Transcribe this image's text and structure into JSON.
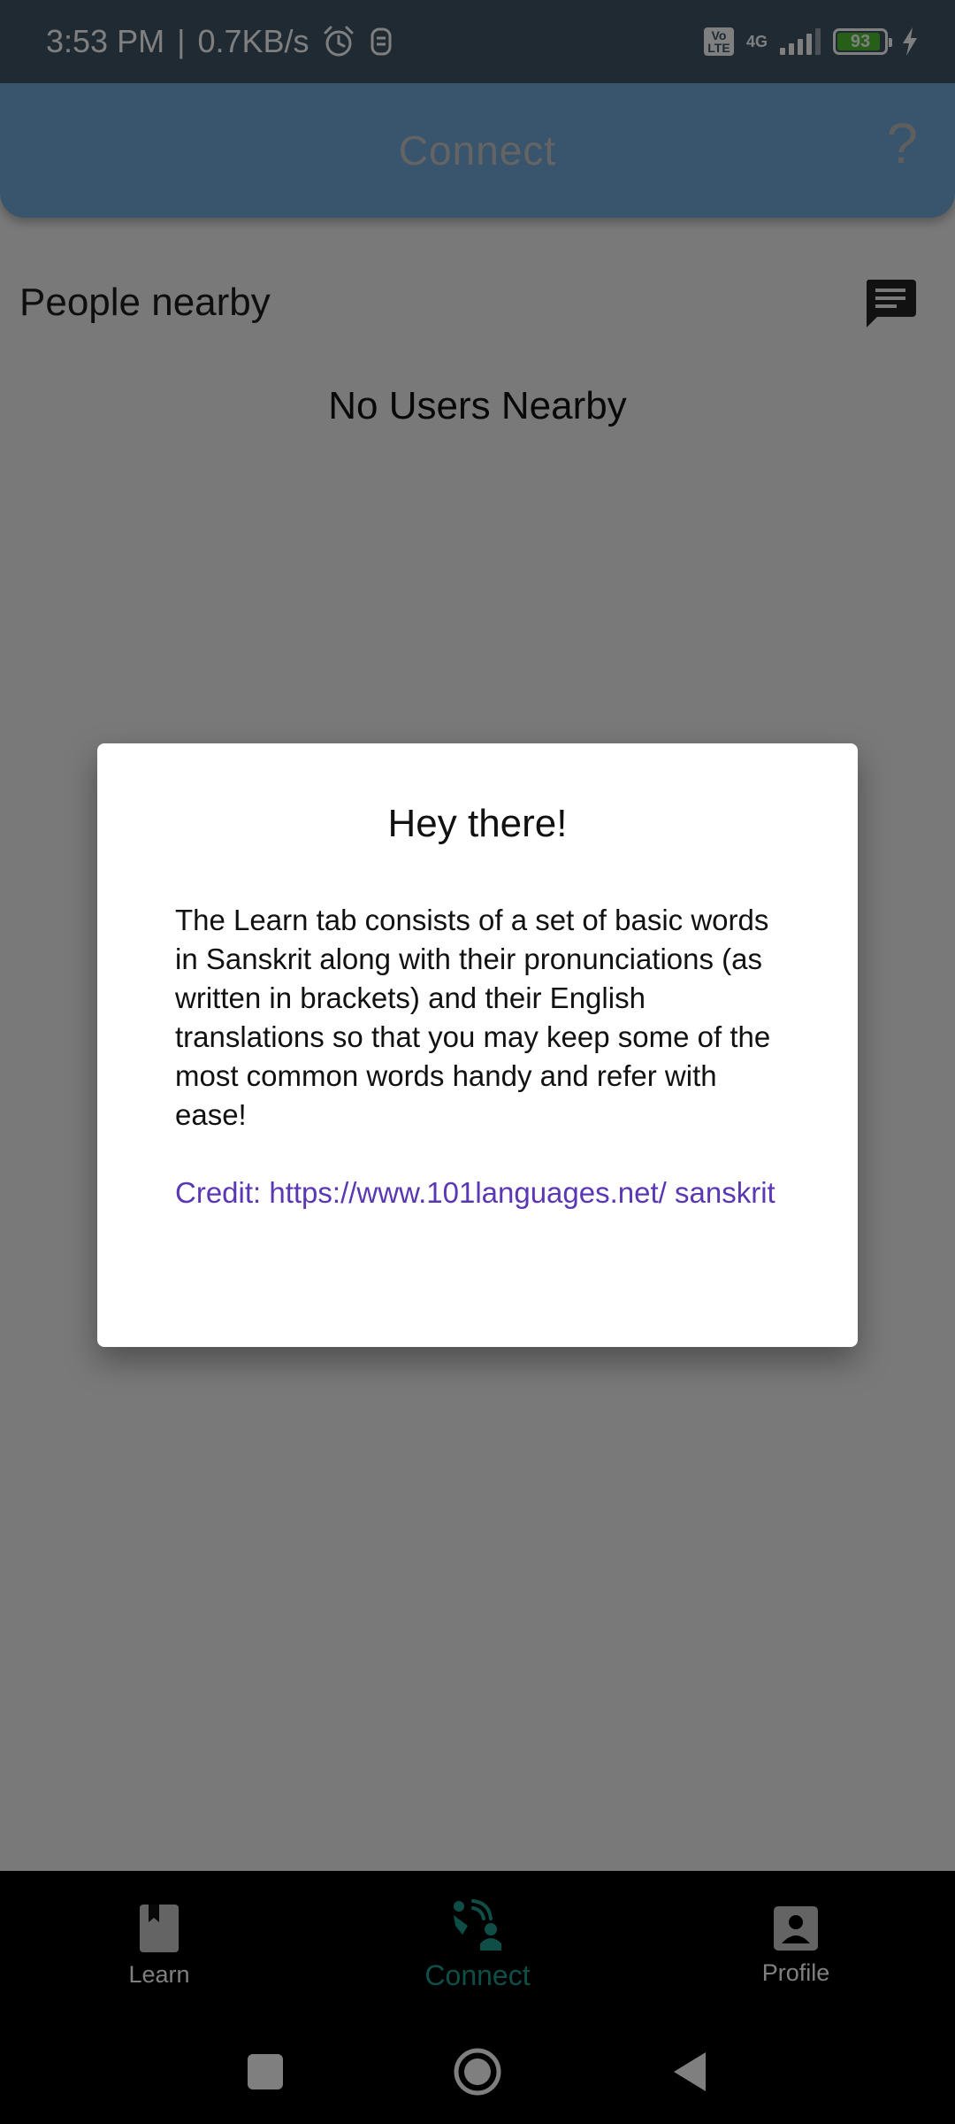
{
  "status_bar": {
    "time": "3:53 PM",
    "separator": "|",
    "speed": "0.7KB/s",
    "volte": "Vo LTE",
    "network": "4G",
    "battery": "93",
    "battery_level": 0.93
  },
  "app_bar": {
    "title": "Connect",
    "help": "?"
  },
  "section": {
    "title": "People nearby",
    "empty_message": "No Users Nearby"
  },
  "dialog": {
    "title": "Hey there!",
    "body": "The Learn tab consists of a set of basic words in Sanskrit along with their pronunciations (as written in brackets) and their English translations so that you may keep some of the most common words handy and refer with ease!",
    "credit": "Credit: https://www.101languages.net/ sanskrit"
  },
  "bottom_nav": {
    "items": [
      {
        "label": "Learn",
        "icon": "book-icon",
        "active": false
      },
      {
        "label": "Connect",
        "icon": "connect-icon",
        "active": true
      },
      {
        "label": "Profile",
        "icon": "profile-icon",
        "active": false
      }
    ]
  },
  "colors": {
    "status_bar": "#3f5566",
    "app_bar": "#73a9da",
    "accent_connect": "#1f9c8c",
    "link": "#5a37b3"
  }
}
